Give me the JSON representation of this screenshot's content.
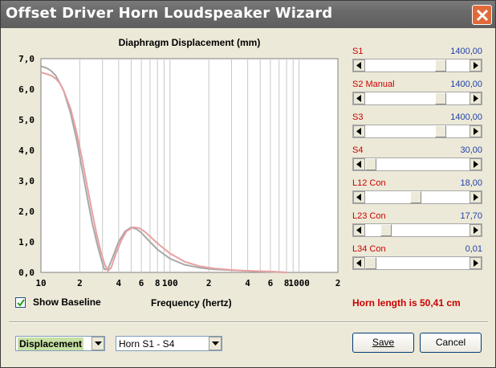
{
  "window": {
    "title": "Offset Driver Horn Loudspeaker Wizard"
  },
  "chart_data": {
    "type": "line",
    "title": "Diaphragm Displacement (mm)",
    "xlabel": "Frequency (hertz)",
    "ylabel": "",
    "x_scale": "log",
    "xlim": [
      10,
      2000
    ],
    "ylim": [
      0,
      7
    ],
    "x_tick_labels": [
      "10",
      "2",
      "4",
      "6",
      "8",
      "100",
      "2",
      "4",
      "6",
      "8",
      "1000",
      "2"
    ],
    "y_tick_labels": [
      "7,0",
      "6,0",
      "5,0",
      "4,0",
      "3,0",
      "2,0",
      "1,0",
      "0,0"
    ],
    "grid": true,
    "colors": {
      "grid": "#c8c8c8",
      "baseline": "#a8a8a8",
      "current": "#e8a0a0"
    },
    "series": [
      {
        "role": "baseline",
        "x": [
          10,
          11,
          12,
          13,
          14,
          15,
          17,
          19,
          21,
          23,
          25,
          27,
          29,
          31,
          33,
          36,
          40,
          45,
          50,
          55,
          60,
          70,
          80,
          100,
          130,
          170,
          220,
          300,
          400,
          600,
          800
        ],
        "y": [
          6.75,
          6.7,
          6.6,
          6.45,
          6.2,
          5.95,
          5.2,
          4.3,
          3.3,
          2.4,
          1.6,
          1.0,
          0.5,
          0.1,
          0.1,
          0.5,
          1.0,
          1.35,
          1.47,
          1.42,
          1.3,
          1.0,
          0.75,
          0.45,
          0.25,
          0.15,
          0.1,
          0.07,
          0.05,
          0.02,
          0.0
        ]
      },
      {
        "role": "current",
        "x": [
          10,
          11,
          12,
          13,
          14,
          15,
          17,
          19,
          21,
          23,
          25,
          27,
          29,
          31,
          33,
          35,
          38,
          42,
          46,
          52,
          58,
          64,
          70,
          80,
          100,
          130,
          170,
          220,
          300,
          400,
          600,
          800
        ],
        "y": [
          6.55,
          6.5,
          6.45,
          6.35,
          6.2,
          5.95,
          5.35,
          4.55,
          3.65,
          2.75,
          1.95,
          1.25,
          0.7,
          0.3,
          0.05,
          0.15,
          0.6,
          1.05,
          1.35,
          1.48,
          1.45,
          1.33,
          1.18,
          0.95,
          0.62,
          0.35,
          0.2,
          0.13,
          0.08,
          0.05,
          0.03,
          0.0
        ]
      }
    ]
  },
  "sliders": [
    {
      "label": "S1",
      "value": "1400,00",
      "level": 0.75
    },
    {
      "label": "S2  Manual",
      "value": "1400,00",
      "level": 0.75
    },
    {
      "label": "S3",
      "value": "1400,00",
      "level": 0.75
    },
    {
      "label": "S4",
      "value": "30,00",
      "level": 0.0
    },
    {
      "label": "L12  Con",
      "value": "18,00",
      "level": 0.48
    },
    {
      "label": "L23  Con",
      "value": "17,70",
      "level": 0.16
    },
    {
      "label": "L34  Con",
      "value": "0,01",
      "level": 0.0
    }
  ],
  "baseline": {
    "label": "Show Baseline",
    "checked": true
  },
  "horn_length": "Horn length is 50,41 cm",
  "controls": {
    "display_select": "Displacement",
    "horn_select": "Horn S1 - S4",
    "save": "Save",
    "cancel": "Cancel"
  }
}
